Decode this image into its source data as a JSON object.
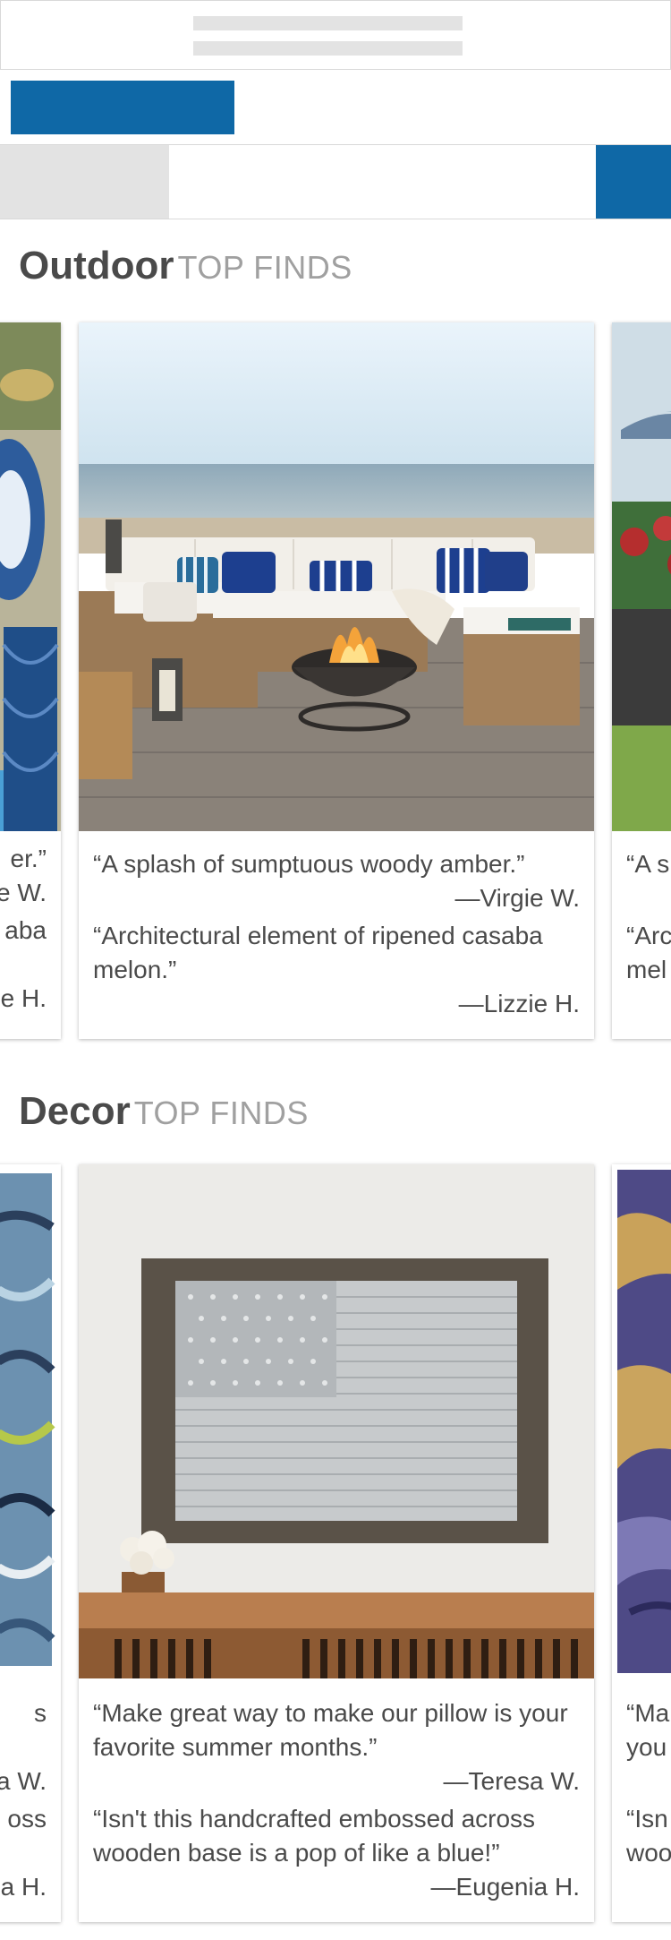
{
  "sections": [
    {
      "title": "Outdoor",
      "subtitle": "TOP FINDS",
      "prev_card": {
        "q1": "er.”",
        "a1": "e W.",
        "q2": "aba",
        "a2": "e H."
      },
      "card": {
        "quote1": "“A splash of sumptuous woody amber.”",
        "author1": "—Virgie  W.",
        "quote2": "“Architectural element of ripened casaba melon.”",
        "author2": "—Lizzie H."
      },
      "next_card": {
        "q1": "“A s",
        "q2a": "“Arc",
        "q2b": "mel"
      }
    },
    {
      "title": "Decor",
      "subtitle": "TOP FINDS",
      "prev_card": {
        "q1": "s",
        "a1": "a W.",
        "q2": "oss",
        "a2": "a H."
      },
      "card": {
        "quote1": "“Make great way to make our pillow is your favorite summer months.”",
        "author1": "—Teresa W.",
        "quote2": "“Isn't this handcrafted embossed across wooden base is a pop of like a blue!”",
        "author2": "—Eugenia H."
      },
      "next_card": {
        "q1a": "“Ma",
        "q1b": "you",
        "q2a": "“Isn",
        "q2b": "woo"
      }
    }
  ],
  "colors": {
    "accent_blue": "#0f68a6",
    "skeleton_grey": "#e3e3e3"
  }
}
